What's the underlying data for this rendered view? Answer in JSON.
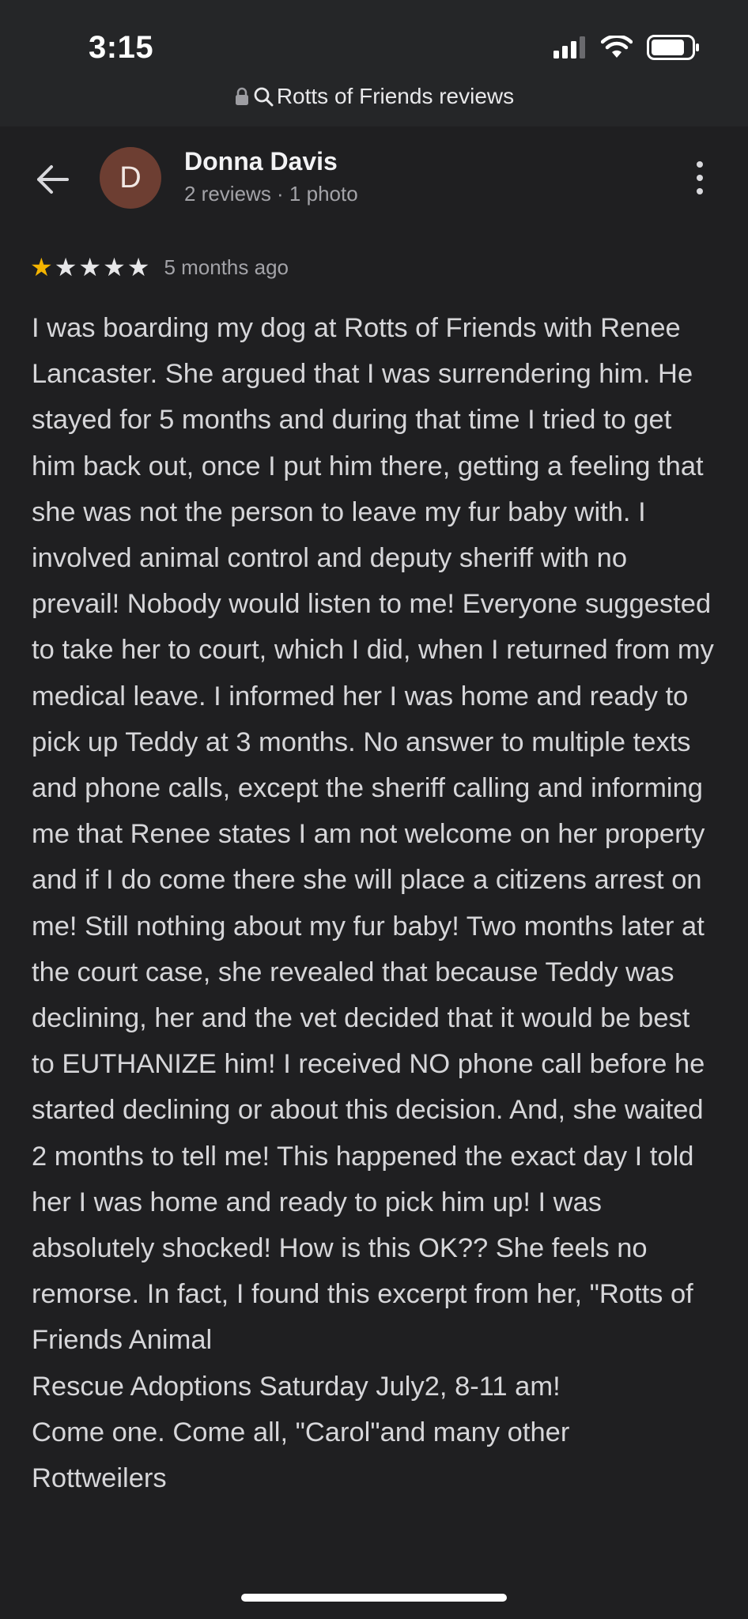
{
  "status_bar": {
    "time": "3:15",
    "icons": [
      "signal-icon",
      "wifi-icon",
      "battery-icon"
    ]
  },
  "url_bar": {
    "text": "Rotts of Friends reviews",
    "icons": [
      "lock-icon",
      "search-icon"
    ]
  },
  "reviewer": {
    "avatar_initial": "D",
    "avatar_color": "#6d3e32",
    "name": "Donna Davis",
    "meta": "2 reviews · 1 photo"
  },
  "review": {
    "rating": 1,
    "max_rating": 5,
    "star_color": "#f4b400",
    "date": "5 months ago",
    "text": "I was boarding my dog at Rotts of Friends with Renee Lancaster. She argued that I was surrendering him. He stayed for 5 months and during that time I tried to get him back out, once I put him there, getting a feeling that she was not the person to leave my fur baby with. I involved animal control and deputy sheriff with no prevail! Nobody would listen to me! Everyone suggested to take her to court, which I did, when I returned from my medical leave. I informed her I was home and ready to pick up Teddy at 3 months. No answer to multiple texts and phone calls, except the sheriff calling and informing me that Renee states I am not welcome on her property and if I do come there she will place a citizens arrest on me! Still nothing about my fur baby! Two months later at the court case, she revealed that because Teddy was declining, her and the vet decided that it would be best to EUTHANIZE him! I received NO phone call before he started declining or about this decision. And, she waited 2 months to tell me! This happened the exact day I told her I was home and ready to pick him up! I was absolutely shocked! How is this OK?? She feels no remorse. In fact, I found this excerpt from her, \"Rotts of Friends Animal\nRescue Adoptions Saturday July2, 8-11 am!\nCome one. Come all, \"Carol\"and many other\nRottweilers"
  }
}
